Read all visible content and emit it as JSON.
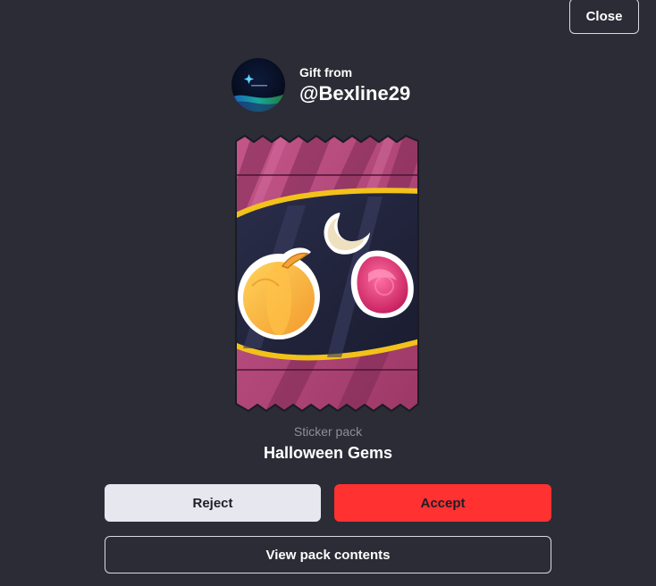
{
  "dialog": {
    "close_label": "Close",
    "sender": {
      "gift_from_label": "Gift from",
      "username": "@Bexline29",
      "avatar_icon": "galaxy-avatar-icon"
    },
    "pack": {
      "type_label": "Sticker pack",
      "name": "Halloween Gems",
      "image_icon": "sticker-pack-icon",
      "stickers": [
        "pumpkin",
        "moon",
        "gem"
      ]
    },
    "actions": {
      "reject_label": "Reject",
      "accept_label": "Accept",
      "view_contents_label": "View pack contents"
    }
  },
  "colors": {
    "background": "#2b2c36",
    "accept": "#ff3131",
    "reject": "#e6e7ef",
    "muted_text": "#8d8e99",
    "pack_pink": "#b8487a",
    "pack_gold": "#f2c21b"
  }
}
